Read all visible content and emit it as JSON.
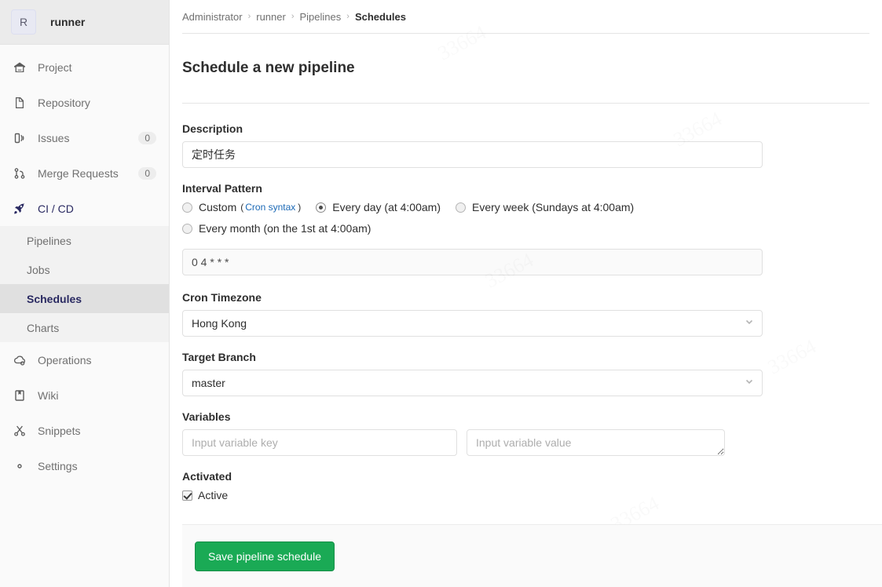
{
  "sidebar": {
    "project_initial": "R",
    "project_name": "runner",
    "items": [
      {
        "label": "Project",
        "icon": "home-icon",
        "badge": null,
        "active": false
      },
      {
        "label": "Repository",
        "icon": "document-icon",
        "badge": null,
        "active": false
      },
      {
        "label": "Issues",
        "icon": "issues-icon",
        "badge": "0",
        "active": false
      },
      {
        "label": "Merge Requests",
        "icon": "merge-request-icon",
        "badge": "0",
        "active": false
      },
      {
        "label": "CI / CD",
        "icon": "rocket-icon",
        "badge": null,
        "active": true
      }
    ],
    "cicd_subitems": [
      {
        "label": "Pipelines",
        "active": false
      },
      {
        "label": "Jobs",
        "active": false
      },
      {
        "label": "Schedules",
        "active": true
      },
      {
        "label": "Charts",
        "active": false
      }
    ],
    "items_after": [
      {
        "label": "Operations",
        "icon": "operations-icon",
        "badge": null,
        "active": false
      },
      {
        "label": "Wiki",
        "icon": "wiki-icon",
        "badge": null,
        "active": false
      },
      {
        "label": "Snippets",
        "icon": "snippets-icon",
        "badge": null,
        "active": false
      },
      {
        "label": "Settings",
        "icon": "gear-icon",
        "badge": null,
        "active": false
      }
    ]
  },
  "breadcrumb": {
    "items": [
      "Administrator",
      "runner",
      "Pipelines"
    ],
    "current": "Schedules",
    "separator": "›"
  },
  "page": {
    "title": "Schedule a new pipeline"
  },
  "form": {
    "description": {
      "label": "Description",
      "value": "定时任务"
    },
    "interval": {
      "label": "Interval Pattern",
      "options": [
        {
          "label": "Custom",
          "suffix_open": "(",
          "link": "Cron syntax",
          "suffix_close": ")",
          "selected": false
        },
        {
          "label": "Every day (at 4:00am)",
          "selected": true
        },
        {
          "label": "Every week (Sundays at 4:00am)",
          "selected": false
        },
        {
          "label": "Every month (on the 1st at 4:00am)",
          "selected": false
        }
      ],
      "cron_value": "0 4 * * *"
    },
    "timezone": {
      "label": "Cron Timezone",
      "value": "Hong Kong"
    },
    "target_branch": {
      "label": "Target Branch",
      "value": "master"
    },
    "variables": {
      "label": "Variables",
      "key_placeholder": "Input variable key",
      "key_value": "",
      "value_placeholder": "Input variable value",
      "value_value": ""
    },
    "activated": {
      "label": "Activated",
      "checkbox_label": "Active",
      "checked": true
    },
    "submit_label": "Save pipeline schedule"
  },
  "colors": {
    "accent_green": "#1aaa55",
    "link_blue": "#1b69b6",
    "active_nav": "#292961"
  }
}
